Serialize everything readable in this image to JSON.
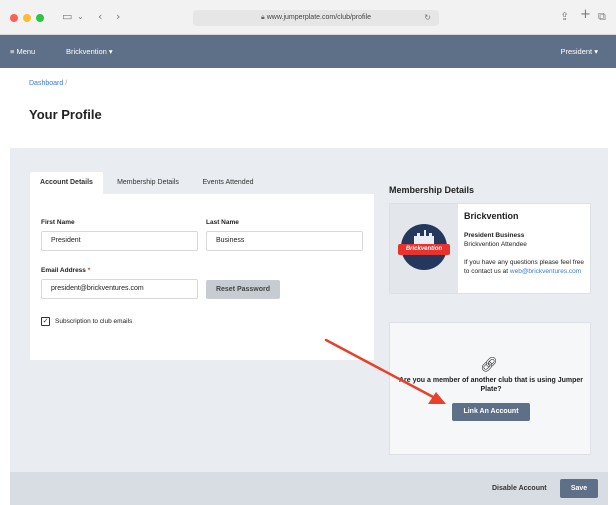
{
  "browser": {
    "url": "www.jumperplate.com/club/profile"
  },
  "navbar": {
    "menu_label": "≡ Menu",
    "club_label": "Brickvention ▾",
    "user_label": "President ▾"
  },
  "breadcrumb": {
    "dashboard": "Dashboard",
    "separator": "/"
  },
  "page": {
    "title": "Your Profile"
  },
  "tabs": [
    {
      "label": "Account Details"
    },
    {
      "label": "Membership Details"
    },
    {
      "label": "Events Attended"
    }
  ],
  "account": {
    "first_name_label": "First Name",
    "first_name_value": "President",
    "last_name_label": "Last Name",
    "last_name_value": "Business",
    "email_label": "Email Address",
    "email_required": "*",
    "email_value": "president@brickventures.com",
    "reset_password": "Reset Password",
    "subscription_label": "Subscription to club emails",
    "subscription_checked": true
  },
  "membership": {
    "heading": "Membership Details",
    "club_name": "Brickvention",
    "logo_text": "Brickvention",
    "role": "President Business",
    "sub_role": "Brickvention Attendee",
    "contact_text": "If you have any questions please feel free to contact us at",
    "contact_email": "web@brickventures.com"
  },
  "link_account": {
    "question": "Are you a member of another club that is using Jumper Plate?",
    "button": "Link An Account"
  },
  "footer": {
    "disable": "Disable Account",
    "save": "Save"
  },
  "colors": {
    "nav": "#5e6f88",
    "link": "#3a7bd5",
    "annotation": "#e8402a"
  }
}
